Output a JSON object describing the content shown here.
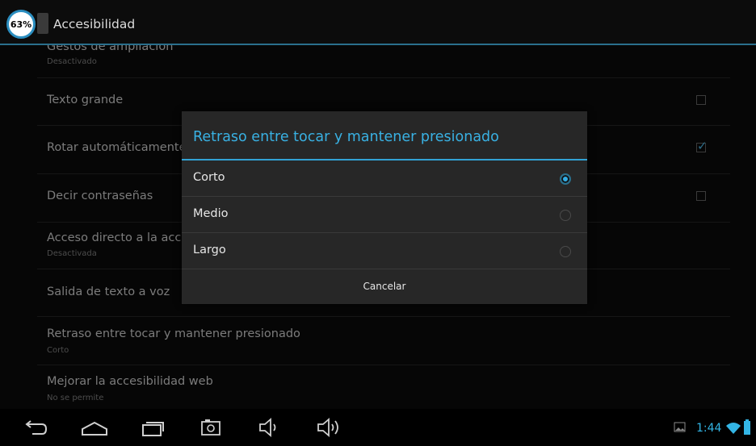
{
  "status": {
    "battery_percent": "63%",
    "time": "1:44"
  },
  "actionbar": {
    "title": "Accesibilidad"
  },
  "list": {
    "items": [
      {
        "title": "Gestos de ampliación",
        "subtitle": "Desactivado"
      },
      {
        "title": "Texto grande",
        "checked": false
      },
      {
        "title": "Rotar automáticamente",
        "checked": true
      },
      {
        "title": "Decir contraseñas",
        "checked": false
      },
      {
        "title": "Acceso directo a la accesibilidad",
        "subtitle": "Desactivada"
      },
      {
        "title": "Salida de texto a voz"
      },
      {
        "title": "Retraso entre tocar y mantener presionado",
        "subtitle": "Corto"
      },
      {
        "title": "Mejorar la accesibilidad web",
        "subtitle": "No se permite"
      }
    ]
  },
  "dialog": {
    "title": "Retraso entre tocar y mantener presionado",
    "options": [
      {
        "label": "Corto",
        "selected": true
      },
      {
        "label": "Medio",
        "selected": false
      },
      {
        "label": "Largo",
        "selected": false
      }
    ],
    "cancel_label": "Cancelar"
  },
  "colors": {
    "accent": "#33b5e5",
    "background": "#000000",
    "dialog": "#272727"
  },
  "navbar": {
    "icons": [
      "back-icon",
      "home-icon",
      "recents-icon",
      "screenshot-icon",
      "volume-down-icon",
      "volume-up-icon"
    ]
  }
}
